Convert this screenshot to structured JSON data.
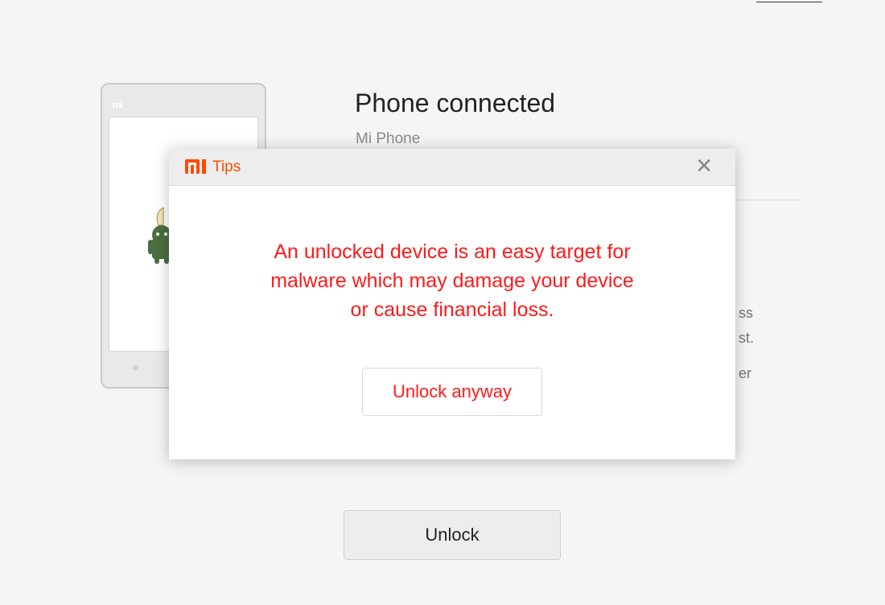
{
  "top_link": {
    "chevron": "<"
  },
  "phone_illustration": {
    "logo": "mi",
    "menu_icon": "≡",
    "icon": "android-icon"
  },
  "device_info": {
    "title": "Phone connected",
    "subtitle": "Mi Phone",
    "note_fragments": [
      "ss",
      "st.",
      "er"
    ]
  },
  "unlock_button": {
    "label": "Unlock"
  },
  "dialog": {
    "title": "Tips",
    "logo_icon": "mi-logo-icon",
    "close_icon": "✕",
    "message_lines": [
      "An unlocked device is an easy target for",
      "malware which may damage your device",
      "or cause financial loss."
    ],
    "action_label": "Unlock anyway",
    "colors": {
      "accent": "#ff4a00",
      "warning": "#ff1a1a"
    }
  }
}
